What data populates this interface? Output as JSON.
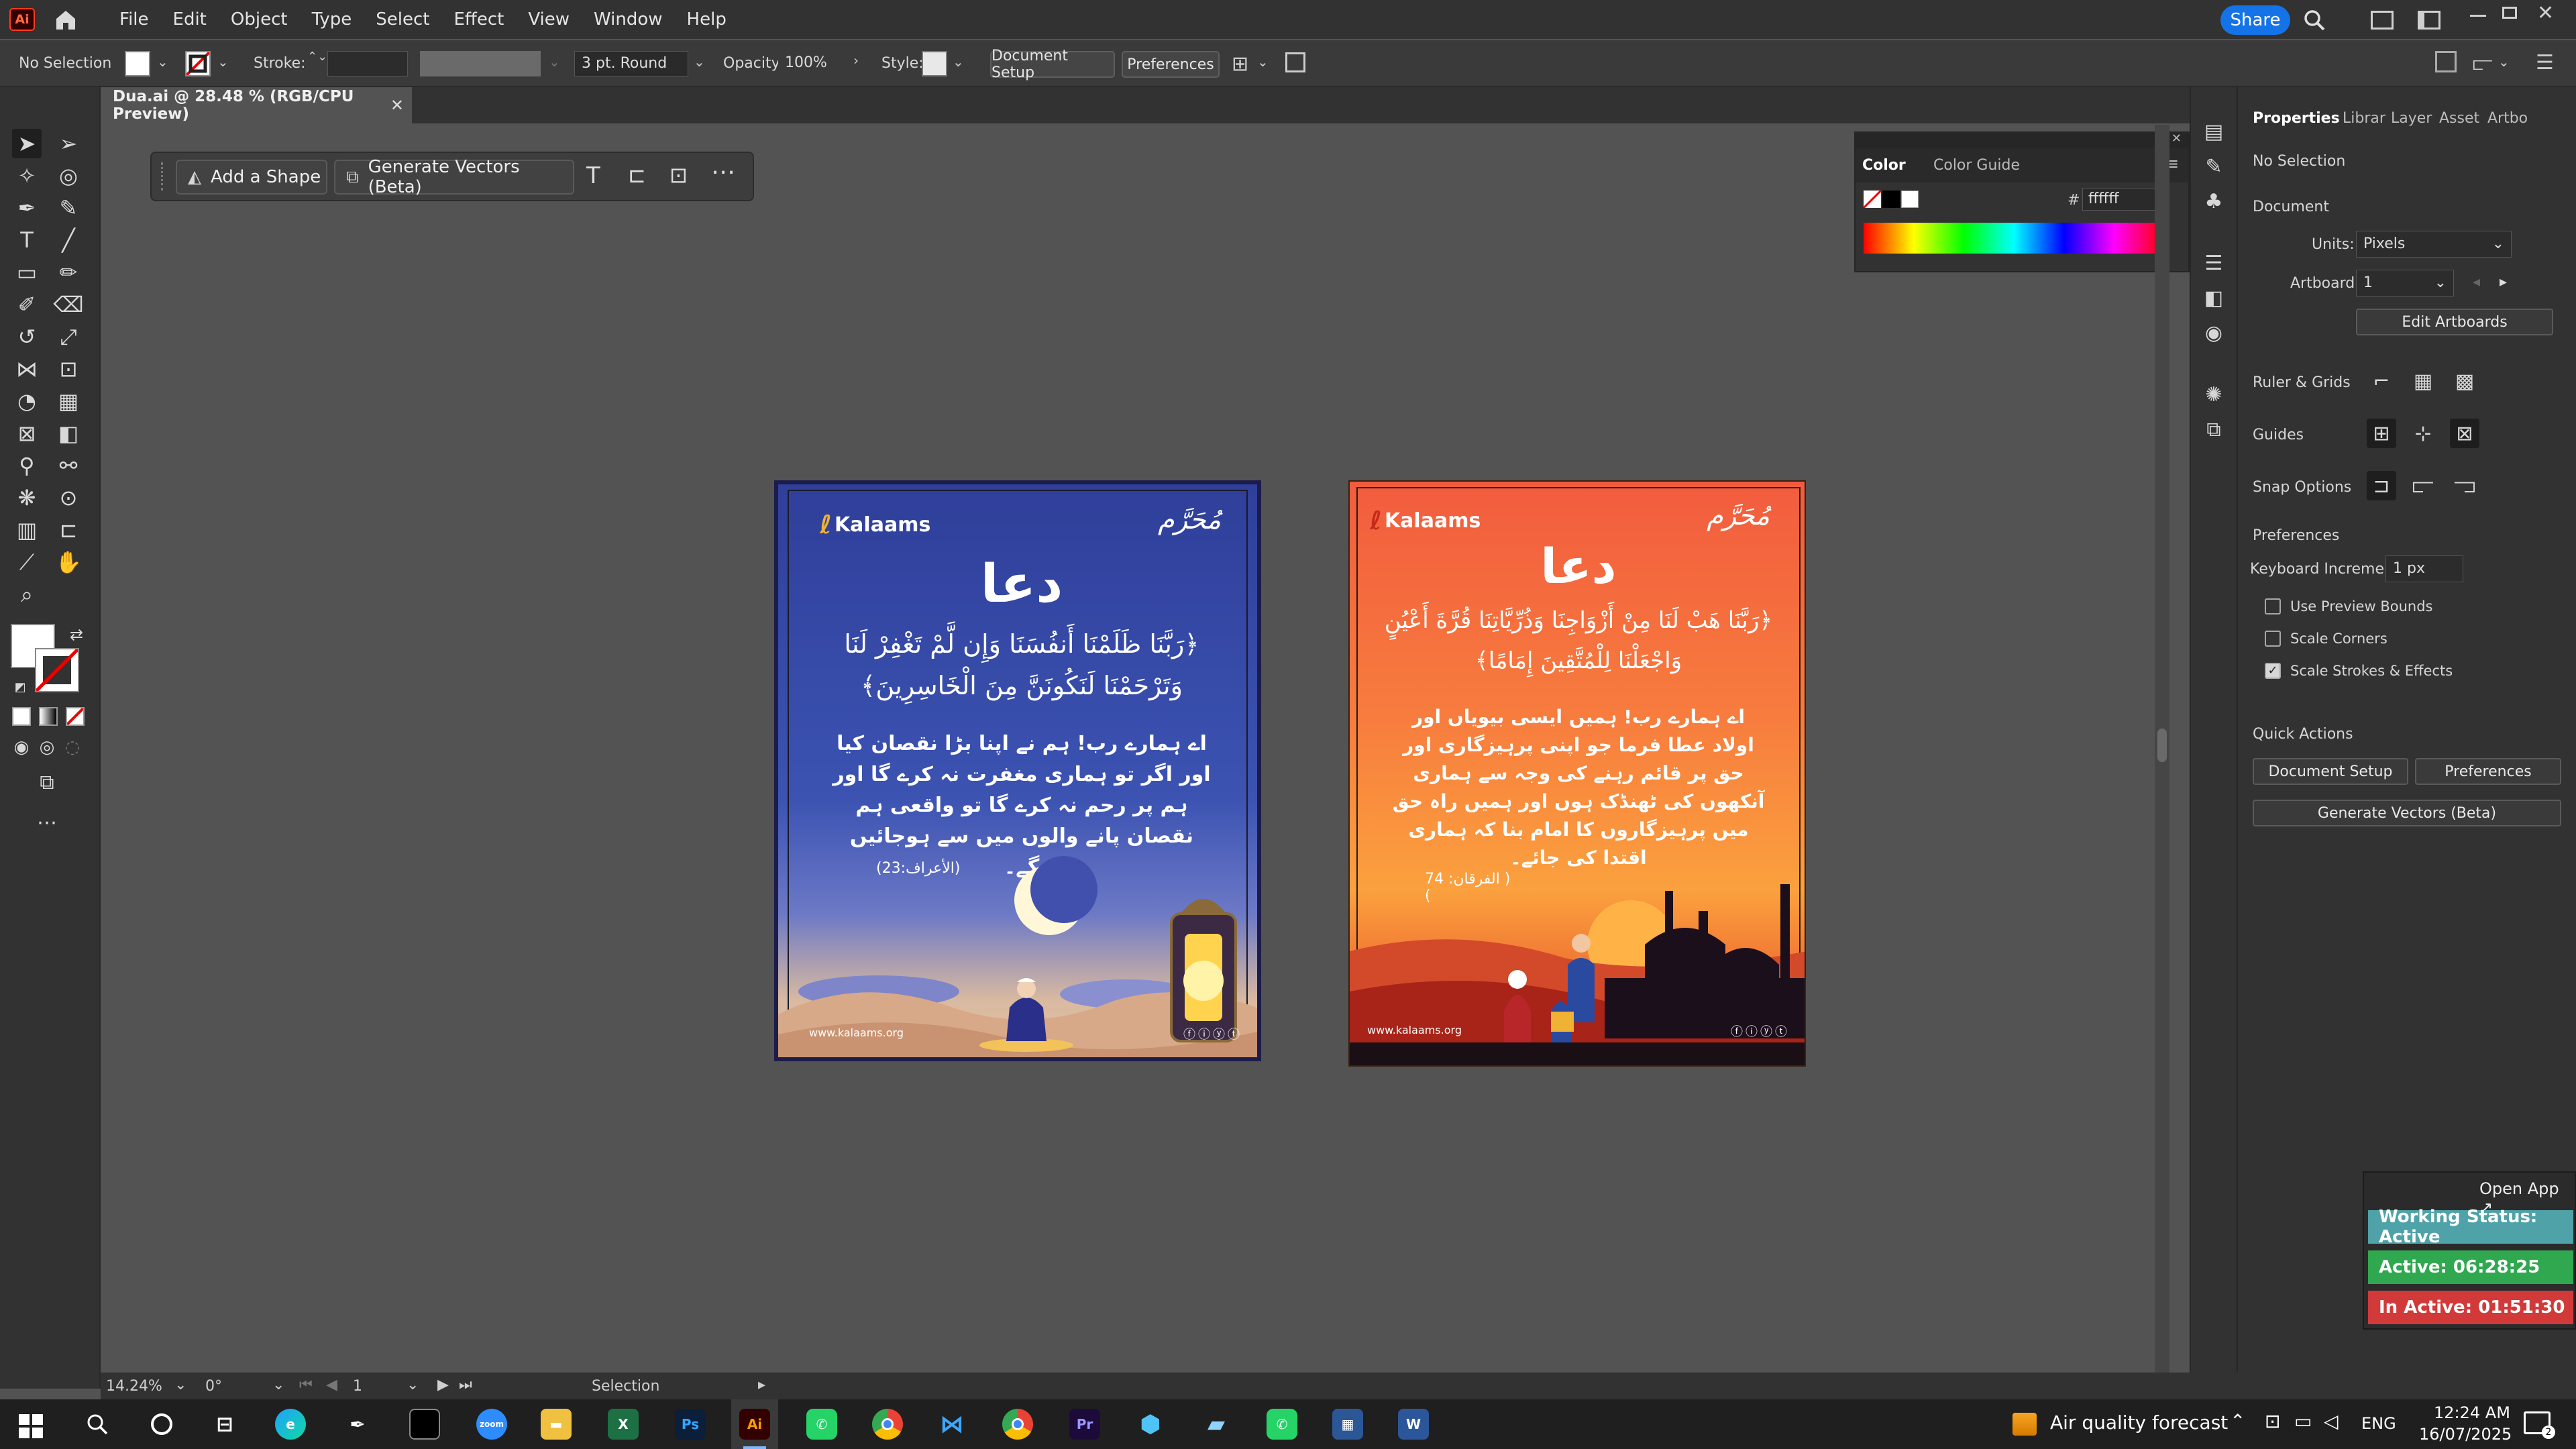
{
  "app": {
    "logo": "Ai",
    "menus": [
      "File",
      "Edit",
      "Object",
      "Type",
      "Select",
      "Effect",
      "View",
      "Window",
      "Help"
    ],
    "share_label": "Share"
  },
  "control": {
    "selection": "No Selection",
    "stroke_label": "Stroke:",
    "brush": "3 pt. Round",
    "opacity_label": "Opacity:",
    "opacity_value": "100%",
    "style_label": "Style:",
    "document_setup": "Document Setup",
    "preferences": "Preferences"
  },
  "document": {
    "tab_title": "Dua.ai @ 28.48 % (RGB/CPU Preview)"
  },
  "context_bar": {
    "add_shape": "Add a Shape",
    "generate_vectors": "Generate Vectors (Beta)"
  },
  "color_panel": {
    "tab_color": "Color",
    "tab_guide": "Color Guide",
    "hash": "#",
    "hex_value": "ffffff"
  },
  "properties": {
    "tabs": [
      "Properties",
      "Librar",
      "Layer",
      "Asset",
      "Artbo"
    ],
    "selection": "No Selection",
    "document_heading": "Document",
    "units_label": "Units:",
    "units_value": "Pixels",
    "artboard_label": "Artboard:",
    "artboard_value": "1",
    "edit_artboards": "Edit Artboards",
    "ruler_grids": "Ruler & Grids",
    "guides": "Guides",
    "snap_options": "Snap Options",
    "preferences_heading": "Preferences",
    "keyboard_increment_label": "Keyboard Increment:",
    "keyboard_increment_value": "1 px",
    "use_preview_bounds": "Use Preview Bounds",
    "scale_corners": "Scale Corners",
    "scale_strokes": "Scale Strokes & Effects",
    "scale_strokes_checked": true,
    "quick_actions": "Quick Actions",
    "qa_document_setup": "Document Setup",
    "qa_preferences": "Preferences",
    "qa_generate_vectors": "Generate Vectors (Beta)"
  },
  "artboard_blue": {
    "brand": "Kalaams",
    "title": "دعا",
    "verse_line1": "﴿رَبَّنَا ظَلَمْنَا أَنفُسَنَا وَإِن لَّمْ تَغْفِرْ لَنَا",
    "verse_line2": "وَتَرْحَمْنَا لَنَكُونَنَّ مِنَ الْخَاسِرِينَ﴾",
    "translation": "اے ہمارے رب! ہم نے اپنا بڑا نقصان کیا اور اگر تو ہماری مغفرت نہ کرے گا اور ہم پر رحم نہ کرے گا تو واقعی ہم نقصان پانے والوں میں سے ہوجائیں گے۔",
    "reference": "(الأعراف:23)",
    "website": "www.kalaams.org"
  },
  "artboard_orange": {
    "brand": "Kalaams",
    "title": "دعا",
    "verse_line1": "﴿رَبَّنَا هَبْ لَنَا مِنْ أَزْوَاجِنَا وَذُرِّيَّاتِنَا قُرَّةَ أَعْيُنٍ",
    "verse_line2": "وَاجْعَلْنَا لِلْمُتَّقِينَ إِمَامًا﴾",
    "translation": "اے ہمارے رب! ہمیں ایسی بیویاں اور اولاد عطا فرما جو اپنی پرہیزگاری اور حق پر قائم رہنے کی وجہ سے ہماری آنکھوں کی ٹھنڈک ہوں اور ہمیں راہ حق میں پرہیزگاروں کا امام بنا کہ ہماری اقتدا کی جائے۔",
    "reference": "( الفرقان: 74 )",
    "website": "www.kalaams.org"
  },
  "status": {
    "zoom": "14.24%",
    "rotation": "0°",
    "artboard_nav": "1",
    "tool": "Selection"
  },
  "widget": {
    "open_app": "Open App ↗",
    "working_status": "Working Status: Active",
    "active": "Active: 06:28:25",
    "inactive": "In Active: 01:51:30",
    "colors": {
      "working": "#4fa3a8",
      "active": "#2fa84f",
      "inactive": "#d23a3a"
    }
  },
  "taskbar": {
    "weather": "Air quality forecast",
    "lang": "ENG",
    "time": "12:24 AM",
    "date": "16/07/2025"
  }
}
